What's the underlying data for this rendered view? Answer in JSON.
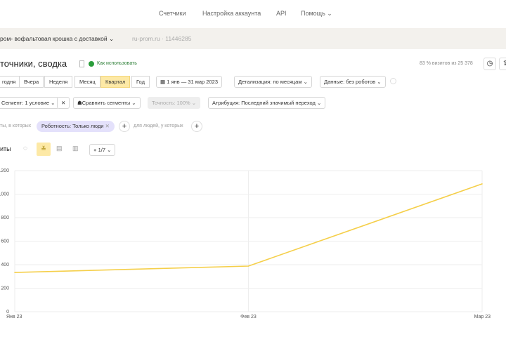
{
  "topnav": {
    "counters": "Счетчики",
    "account": "Настройка аккаунта",
    "api": "API",
    "help": "Помощь"
  },
  "counter": {
    "name": "ром- вофальтовая крошка с доставкой",
    "site": "ru-prom.ru · 11446285"
  },
  "report": {
    "title": "точники, сводка",
    "how_to": "Как использовать",
    "visits_info": "83 % визитов из 25 378"
  },
  "periods": [
    "годня",
    "Вчера",
    "Неделя",
    "Месяц",
    "Квартал",
    "Год"
  ],
  "active_period": "Квартал",
  "date_range": "1 янв — 31 мар 2023",
  "detail": "Детализация: по месяцам",
  "data_filter": "Данные: без роботов",
  "segment": "Сегмент: 1 условие",
  "compare": "Сравнить сегменты",
  "accuracy": "Точность: 100%",
  "attribution": "Атрибуция: Последний значимый переход",
  "filter": {
    "prefix": "ты, в которых",
    "chip": "Роботность: Только люди",
    "people": "для людей, у которых"
  },
  "chart_section": {
    "title": "иты",
    "series_count": "1/7"
  },
  "colors": {
    "accent": "#fcd65c",
    "active_bg": "#fde9a6",
    "line": "#f5cf4a"
  },
  "chart_data": {
    "type": "line",
    "categories": [
      "Янв 23",
      "Фев 23",
      "Мар 23"
    ],
    "values": [
      334,
      388,
      1087
    ],
    "yticks": [
      0,
      200,
      400,
      600,
      800,
      1000,
      1200
    ],
    "ylim": [
      0,
      1200
    ],
    "grid": true
  }
}
